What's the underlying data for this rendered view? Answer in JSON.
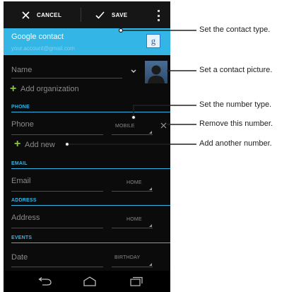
{
  "action_bar": {
    "cancel_label": "CANCEL",
    "save_label": "SAVE"
  },
  "account": {
    "type": "Google contact",
    "email": "your.account@gmail.com",
    "badge_letter": "g"
  },
  "form": {
    "name_placeholder": "Name",
    "add_organization": "Add organization",
    "phone_section": "PHONE",
    "phone_placeholder": "Phone",
    "phone_type": "MOBILE",
    "add_new": "Add new",
    "email_section": "EMAIL",
    "email_placeholder": "Email",
    "email_type": "HOME",
    "address_section": "ADDRESS",
    "address_placeholder": "Address",
    "address_type": "HOME",
    "events_section": "EVENTS",
    "date_placeholder": "Date",
    "date_type": "BIRTHDAY"
  },
  "callouts": [
    "Set the contact type.",
    "Set a contact picture.",
    "Set the number type.",
    "Remove this number.",
    "Add another number."
  ],
  "colors": {
    "accent": "#33b5e5",
    "add": "#8bc34a",
    "background": "#0b0b0b"
  }
}
